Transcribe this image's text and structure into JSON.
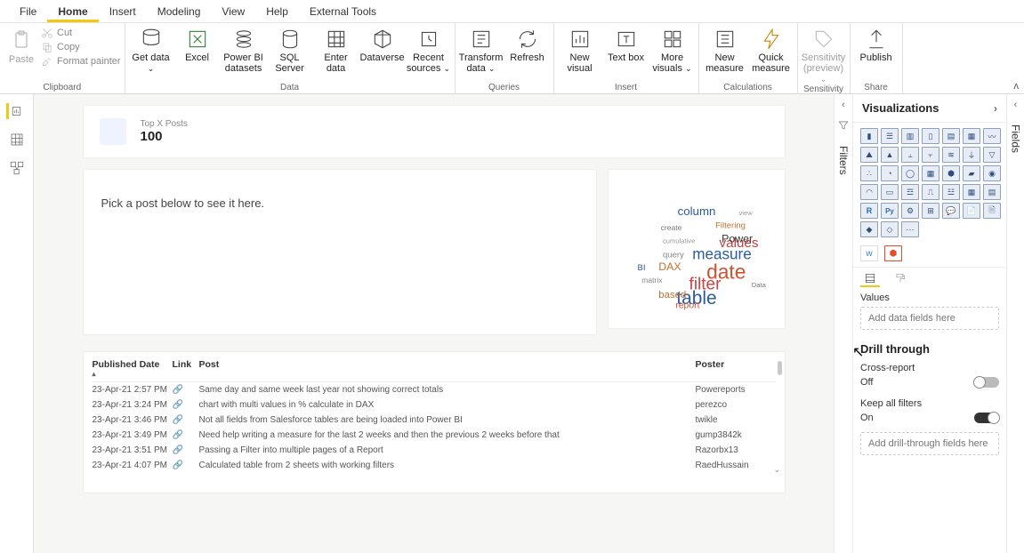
{
  "menu": {
    "items": [
      "File",
      "Home",
      "Insert",
      "Modeling",
      "View",
      "Help",
      "External Tools"
    ],
    "active": 1
  },
  "ribbon": {
    "clipboard": {
      "label": "Clipboard",
      "paste": "Paste",
      "cut": "Cut",
      "copy": "Copy",
      "fmt": "Format painter"
    },
    "data": {
      "label": "Data",
      "getdata": "Get data",
      "excel": "Excel",
      "pbi": "Power BI datasets",
      "sql": "SQL Server",
      "enter": "Enter data",
      "dataverse": "Dataverse",
      "recent": "Recent sources"
    },
    "queries": {
      "label": "Queries",
      "transform": "Transform data",
      "refresh": "Refresh"
    },
    "insert": {
      "label": "Insert",
      "newvis": "New visual",
      "textbox": "Text box",
      "more": "More visuals"
    },
    "calc": {
      "label": "Calculations",
      "newmeas": "New measure",
      "quick": "Quick measure"
    },
    "sens": {
      "label": "Sensitivity",
      "btn": "Sensitivity (preview)"
    },
    "share": {
      "label": "Share",
      "publish": "Publish"
    }
  },
  "canvas": {
    "topcard": {
      "label": "Top X Posts",
      "value": "100"
    },
    "pick": "Pick a post below to see it here.",
    "table": {
      "cols": [
        "Published Date",
        "Link",
        "Post",
        "Poster"
      ],
      "rows": [
        {
          "date": "23-Apr-21 2:57 PM",
          "post": "Same day and same week last year not showing correct totals",
          "poster": "Powereports"
        },
        {
          "date": "23-Apr-21 3:24 PM",
          "post": "chart with multi values in % calculate in DAX",
          "poster": "perezco"
        },
        {
          "date": "23-Apr-21 3:46 PM",
          "post": "Not all fields from Salesforce tables are being loaded into Power BI",
          "poster": "twikle"
        },
        {
          "date": "23-Apr-21 3:49 PM",
          "post": "Need help writing a measure for the last 2 weeks and then the previous 2 weeks before that",
          "poster": "gump3842k"
        },
        {
          "date": "23-Apr-21 3:51 PM",
          "post": "Passing a Filter into multiple pages of a Report",
          "poster": "Razorbx13"
        },
        {
          "date": "23-Apr-21 4:07 PM",
          "post": "Calculated table from 2 sheets with working filters",
          "poster": "RaedHussain"
        }
      ]
    }
  },
  "filters": {
    "label": "Filters"
  },
  "viz": {
    "title": "Visualizations",
    "values_label": "Values",
    "values_placeholder": "Add data fields here",
    "drill": "Drill through",
    "cross": "Cross-report",
    "cross_state": "Off",
    "keep": "Keep all filters",
    "keep_state": "On",
    "drill_placeholder": "Add drill-through fields here"
  },
  "fields": {
    "label": "Fields"
  }
}
